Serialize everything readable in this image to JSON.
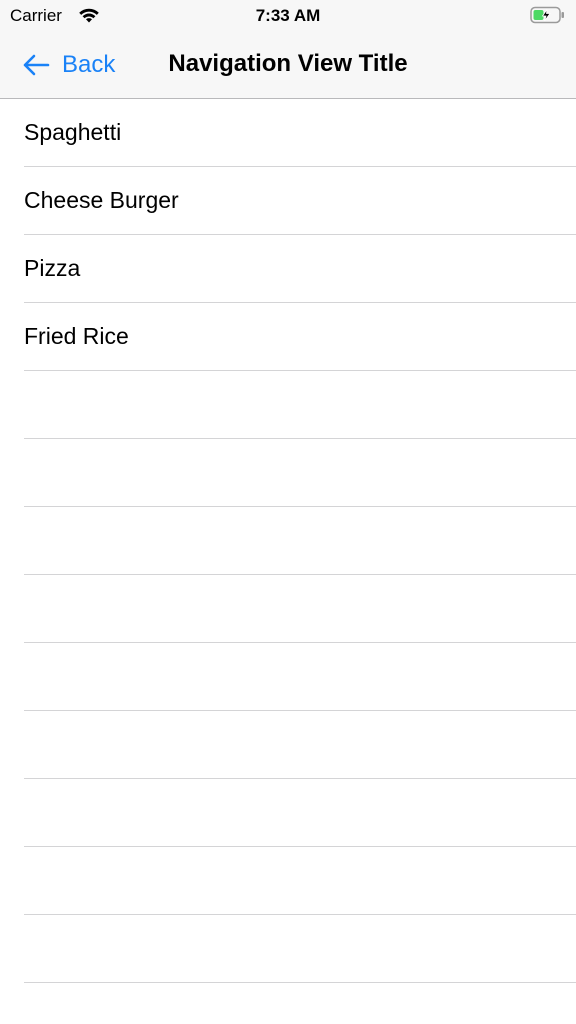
{
  "status_bar": {
    "carrier": "Carrier",
    "time": "7:33 AM",
    "icons": [
      "wifi-icon",
      "battery-charging-icon"
    ]
  },
  "nav_bar": {
    "back_label": "Back",
    "title": "Navigation View Title",
    "back_icon": "back-arrow-icon",
    "accent_color": "#1a82f7"
  },
  "list": {
    "items": [
      {
        "label": "Spaghetti"
      },
      {
        "label": "Cheese Burger"
      },
      {
        "label": "Pizza"
      },
      {
        "label": "Fried Rice"
      }
    ],
    "empty_rows": 9
  }
}
